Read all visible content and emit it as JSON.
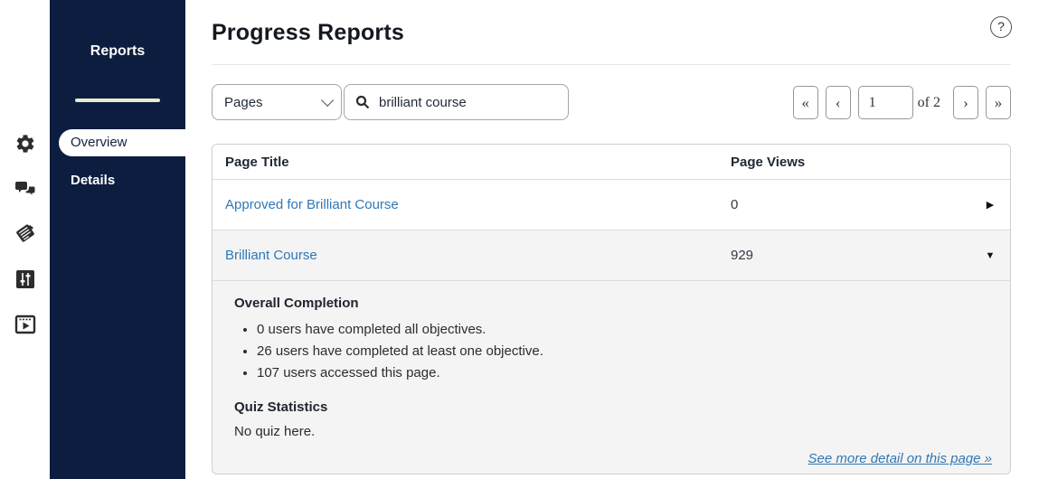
{
  "colors": {
    "sidebar_navy": "#0d1d40",
    "sidebar_divider_cream": "#e7ebd2",
    "link_blue": "#2e78b7",
    "expanded_row_gray": "#f4f4f4"
  },
  "rail_icons": [
    {
      "name": "gear-icon"
    },
    {
      "name": "feedback-chat-icon"
    },
    {
      "name": "tag-notes-icon"
    },
    {
      "name": "sliders-icon"
    },
    {
      "name": "video-player-icon"
    }
  ],
  "sidebar": {
    "title": "Reports",
    "items": [
      {
        "label": "Overview",
        "active": true
      },
      {
        "label": "Details",
        "active": false
      }
    ]
  },
  "header": {
    "title": "Progress Reports",
    "help_label": "?"
  },
  "filters": {
    "type_selected": "Pages",
    "search_value": "brilliant course",
    "search_icon": "magnifier-icon"
  },
  "pagination": {
    "first_label": "«",
    "prev_label": "‹",
    "page_value": "1",
    "of_label": "of 2",
    "next_label": "›",
    "last_label": "»"
  },
  "table": {
    "columns": {
      "title": "Page Title",
      "views": "Page Views"
    },
    "rows": [
      {
        "title": "Approved for Brilliant Course",
        "views": "0",
        "state": "collapsed",
        "arrow": "▶"
      },
      {
        "title": "Brilliant Course",
        "views": "929",
        "state": "expanded",
        "arrow": "▼"
      }
    ]
  },
  "detail": {
    "completion_heading": "Overall Completion",
    "bullets": [
      "0 users have completed all objectives.",
      "26 users have completed at least one objective.",
      "107 users accessed this page."
    ],
    "quiz_heading": "Quiz Statistics",
    "quiz_text": "No quiz here.",
    "more_link": "See more detail on this page »"
  }
}
